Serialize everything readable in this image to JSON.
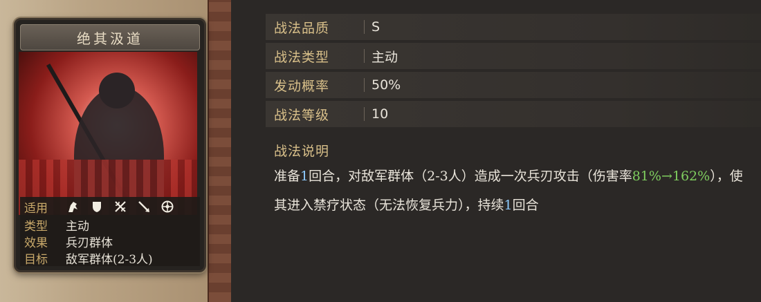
{
  "card": {
    "title": "绝其汲道",
    "rows": {
      "applicable_label": "适用",
      "type_label": "类型",
      "type_value": "主动",
      "effect_label": "效果",
      "effect_value": "兵刃群体",
      "target_label": "目标",
      "target_value": "敌军群体(2-3人)"
    },
    "unit_icons": [
      "cavalry-icon",
      "shield-icon",
      "crossed-bows-icon",
      "spear-icon",
      "siege-icon"
    ]
  },
  "attributes": [
    {
      "label": "战法品质",
      "value": "S"
    },
    {
      "label": "战法类型",
      "value": "主动"
    },
    {
      "label": "发动概率",
      "value": "50%"
    },
    {
      "label": "战法等级",
      "value": "10"
    }
  ],
  "description": {
    "title": "战法说明",
    "part1": "准备",
    "turns1": "1",
    "part2": "回合，对敌军群体（2-3人）造成一次兵刃攻击（伤害率",
    "rate": "81%→162%",
    "part3": "），使其进入禁疗状态（无法恢复兵力），持续",
    "turns2": "1",
    "part4": "回合"
  },
  "colors": {
    "label_gold": "#d9c08a",
    "value_text": "#e9e4da",
    "highlight_green": "#7fce5f",
    "highlight_blue": "#8ecbff"
  }
}
